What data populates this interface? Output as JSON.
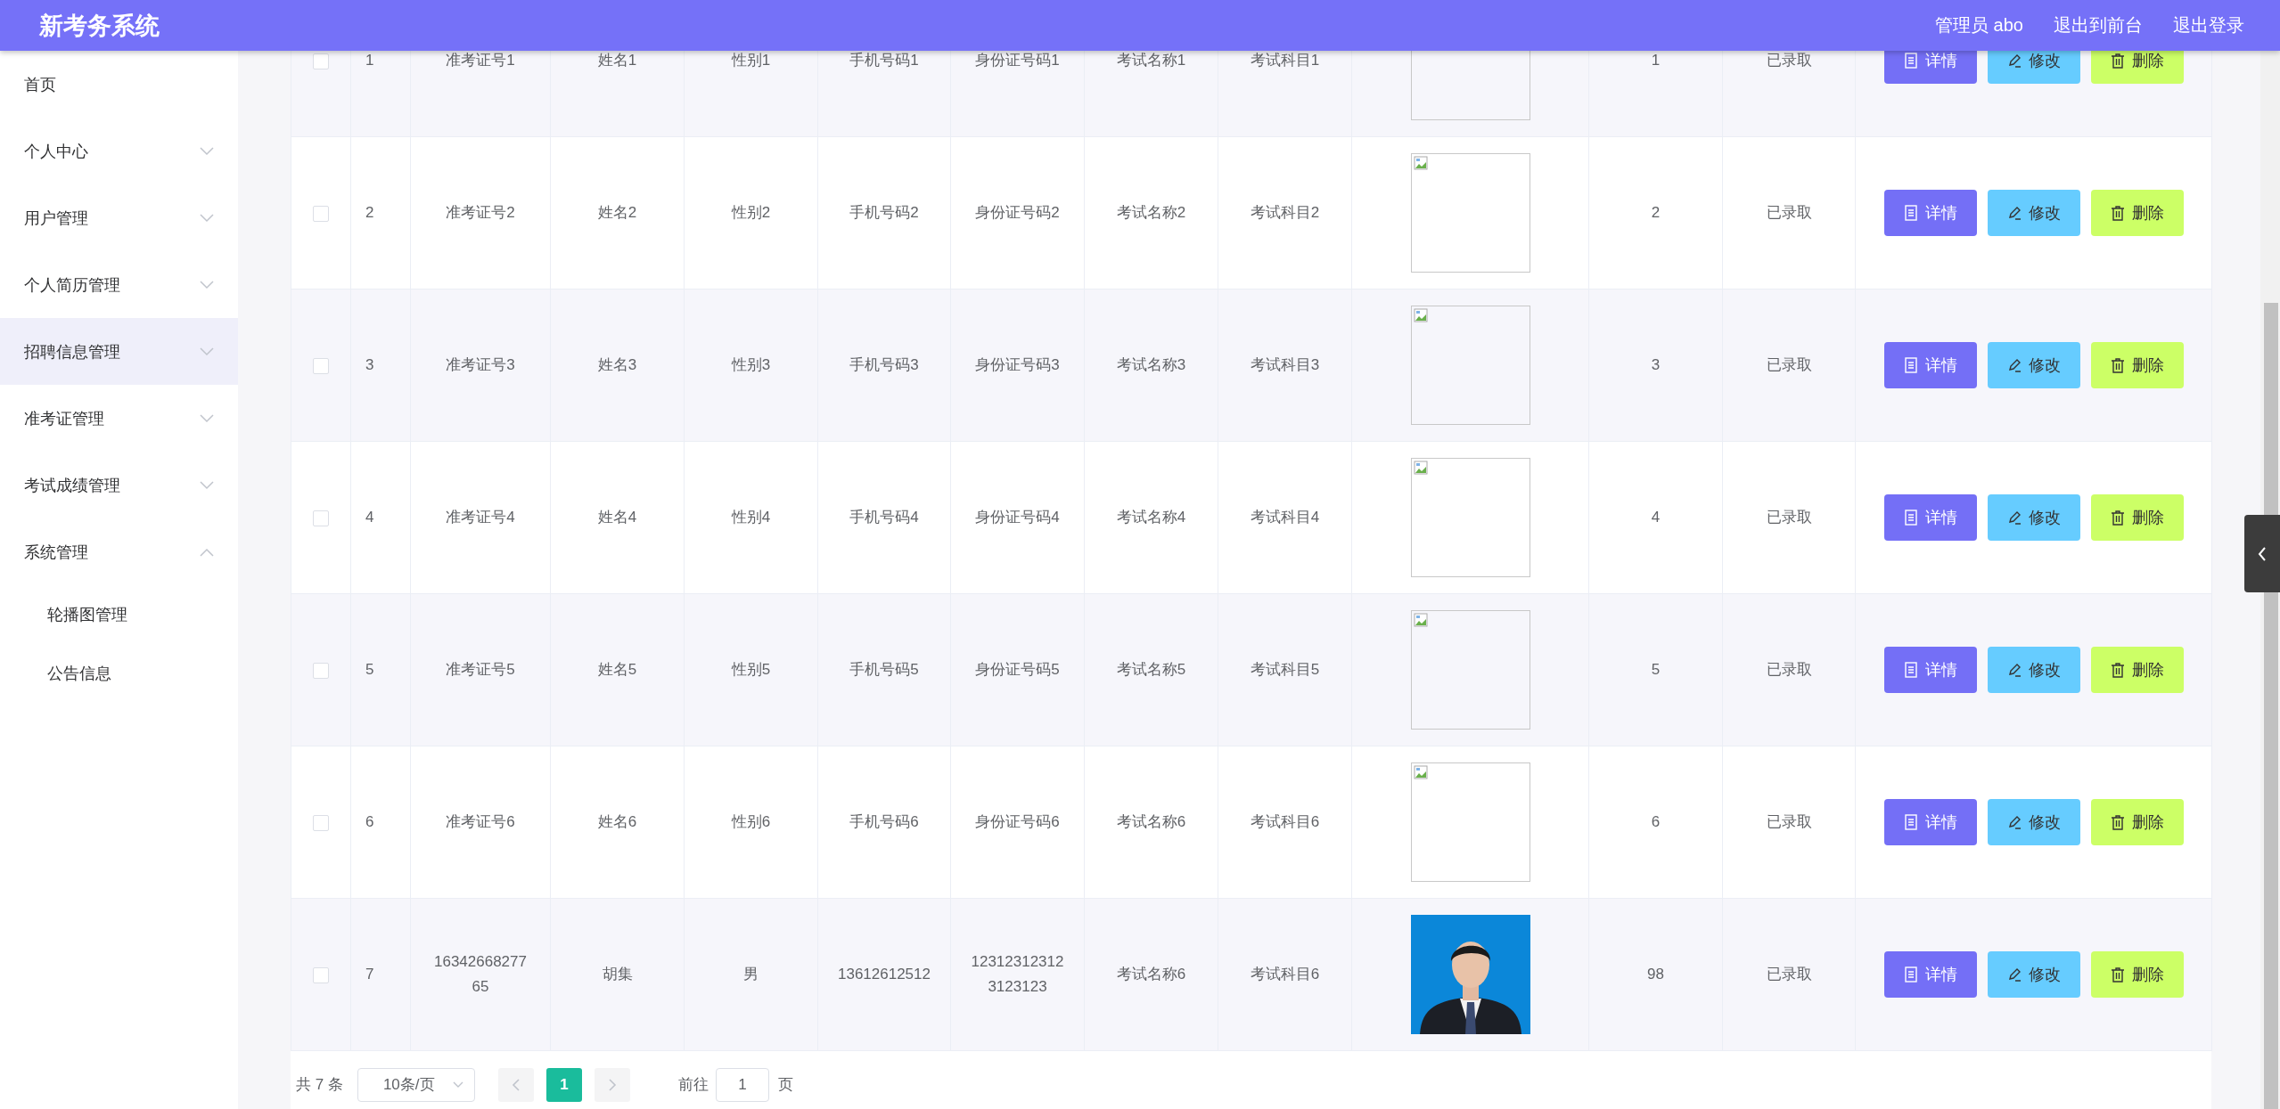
{
  "header": {
    "title": "新考务系统",
    "links": [
      "管理员 abo",
      "退出到前台",
      "退出登录"
    ]
  },
  "sidebar": {
    "items": [
      {
        "label": "首页",
        "expandable": false,
        "hovered": false
      },
      {
        "label": "个人中心",
        "expandable": true,
        "expanded": false,
        "hovered": false
      },
      {
        "label": "用户管理",
        "expandable": true,
        "expanded": false,
        "hovered": false
      },
      {
        "label": "个人简历管理",
        "expandable": true,
        "expanded": false,
        "hovered": false
      },
      {
        "label": "招聘信息管理",
        "expandable": true,
        "expanded": false,
        "hovered": true
      },
      {
        "label": "准考证管理",
        "expandable": true,
        "expanded": false,
        "hovered": false
      },
      {
        "label": "考试成绩管理",
        "expandable": true,
        "expanded": false,
        "hovered": false
      },
      {
        "label": "系统管理",
        "expandable": true,
        "expanded": true,
        "hovered": false,
        "children": [
          {
            "label": "轮播图管理"
          },
          {
            "label": "公告信息"
          }
        ]
      }
    ]
  },
  "table": {
    "rows": [
      {
        "checked": false,
        "cells": [
          "1",
          "准考证号1",
          "姓名1",
          "性别1",
          "手机号码1",
          "身份证号码1",
          "考试名称1",
          "考试科目1"
        ],
        "photo": {
          "kind": "broken"
        },
        "after": [
          "1",
          "已录取"
        ],
        "actions": [
          {
            "kind": "detail",
            "label": "详情"
          },
          {
            "kind": "edit",
            "label": "修改"
          },
          {
            "kind": "delete",
            "label": "删除"
          }
        ]
      },
      {
        "checked": false,
        "cells": [
          "2",
          "准考证号2",
          "姓名2",
          "性别2",
          "手机号码2",
          "身份证号码2",
          "考试名称2",
          "考试科目2"
        ],
        "photo": {
          "kind": "broken"
        },
        "after": [
          "2",
          "已录取"
        ],
        "actions": [
          {
            "kind": "detail",
            "label": "详情"
          },
          {
            "kind": "edit",
            "label": "修改"
          },
          {
            "kind": "delete",
            "label": "删除"
          }
        ]
      },
      {
        "checked": false,
        "cells": [
          "3",
          "准考证号3",
          "姓名3",
          "性别3",
          "手机号码3",
          "身份证号码3",
          "考试名称3",
          "考试科目3"
        ],
        "photo": {
          "kind": "broken"
        },
        "after": [
          "3",
          "已录取"
        ],
        "actions": [
          {
            "kind": "detail",
            "label": "详情"
          },
          {
            "kind": "edit",
            "label": "修改"
          },
          {
            "kind": "delete",
            "label": "删除"
          }
        ]
      },
      {
        "checked": false,
        "cells": [
          "4",
          "准考证号4",
          "姓名4",
          "性别4",
          "手机号码4",
          "身份证号码4",
          "考试名称4",
          "考试科目4"
        ],
        "photo": {
          "kind": "broken"
        },
        "after": [
          "4",
          "已录取"
        ],
        "actions": [
          {
            "kind": "detail",
            "label": "详情"
          },
          {
            "kind": "edit",
            "label": "修改"
          },
          {
            "kind": "delete",
            "label": "删除"
          }
        ]
      },
      {
        "checked": false,
        "cells": [
          "5",
          "准考证号5",
          "姓名5",
          "性别5",
          "手机号码5",
          "身份证号码5",
          "考试名称5",
          "考试科目5"
        ],
        "photo": {
          "kind": "broken"
        },
        "after": [
          "5",
          "已录取"
        ],
        "actions": [
          {
            "kind": "detail",
            "label": "详情"
          },
          {
            "kind": "edit",
            "label": "修改"
          },
          {
            "kind": "delete",
            "label": "删除"
          }
        ]
      },
      {
        "checked": false,
        "cells": [
          "6",
          "准考证号6",
          "姓名6",
          "性别6",
          "手机号码6",
          "身份证号码6",
          "考试名称6",
          "考试科目6"
        ],
        "photo": {
          "kind": "broken"
        },
        "after": [
          "6",
          "已录取"
        ],
        "actions": [
          {
            "kind": "detail",
            "label": "详情"
          },
          {
            "kind": "edit",
            "label": "修改"
          },
          {
            "kind": "delete",
            "label": "删除"
          }
        ]
      },
      {
        "checked": false,
        "cells": [
          "7",
          "1634266827765",
          "胡集",
          "男",
          "13612612512",
          "123123123123123123",
          "考试名称6",
          "考试科目6"
        ],
        "photo": {
          "kind": "picture"
        },
        "after": [
          "98",
          "已录取"
        ],
        "actions": [
          {
            "kind": "detail",
            "label": "详情"
          },
          {
            "kind": "edit",
            "label": "修改"
          },
          {
            "kind": "delete",
            "label": "删除"
          }
        ]
      }
    ]
  },
  "pagination": {
    "total": "共 7 条",
    "page_size": "10条/页",
    "pages": [
      {
        "label": "1",
        "selected": true
      }
    ],
    "goto_label": "前往",
    "goto_value": "1",
    "goto_suffix": "页"
  }
}
